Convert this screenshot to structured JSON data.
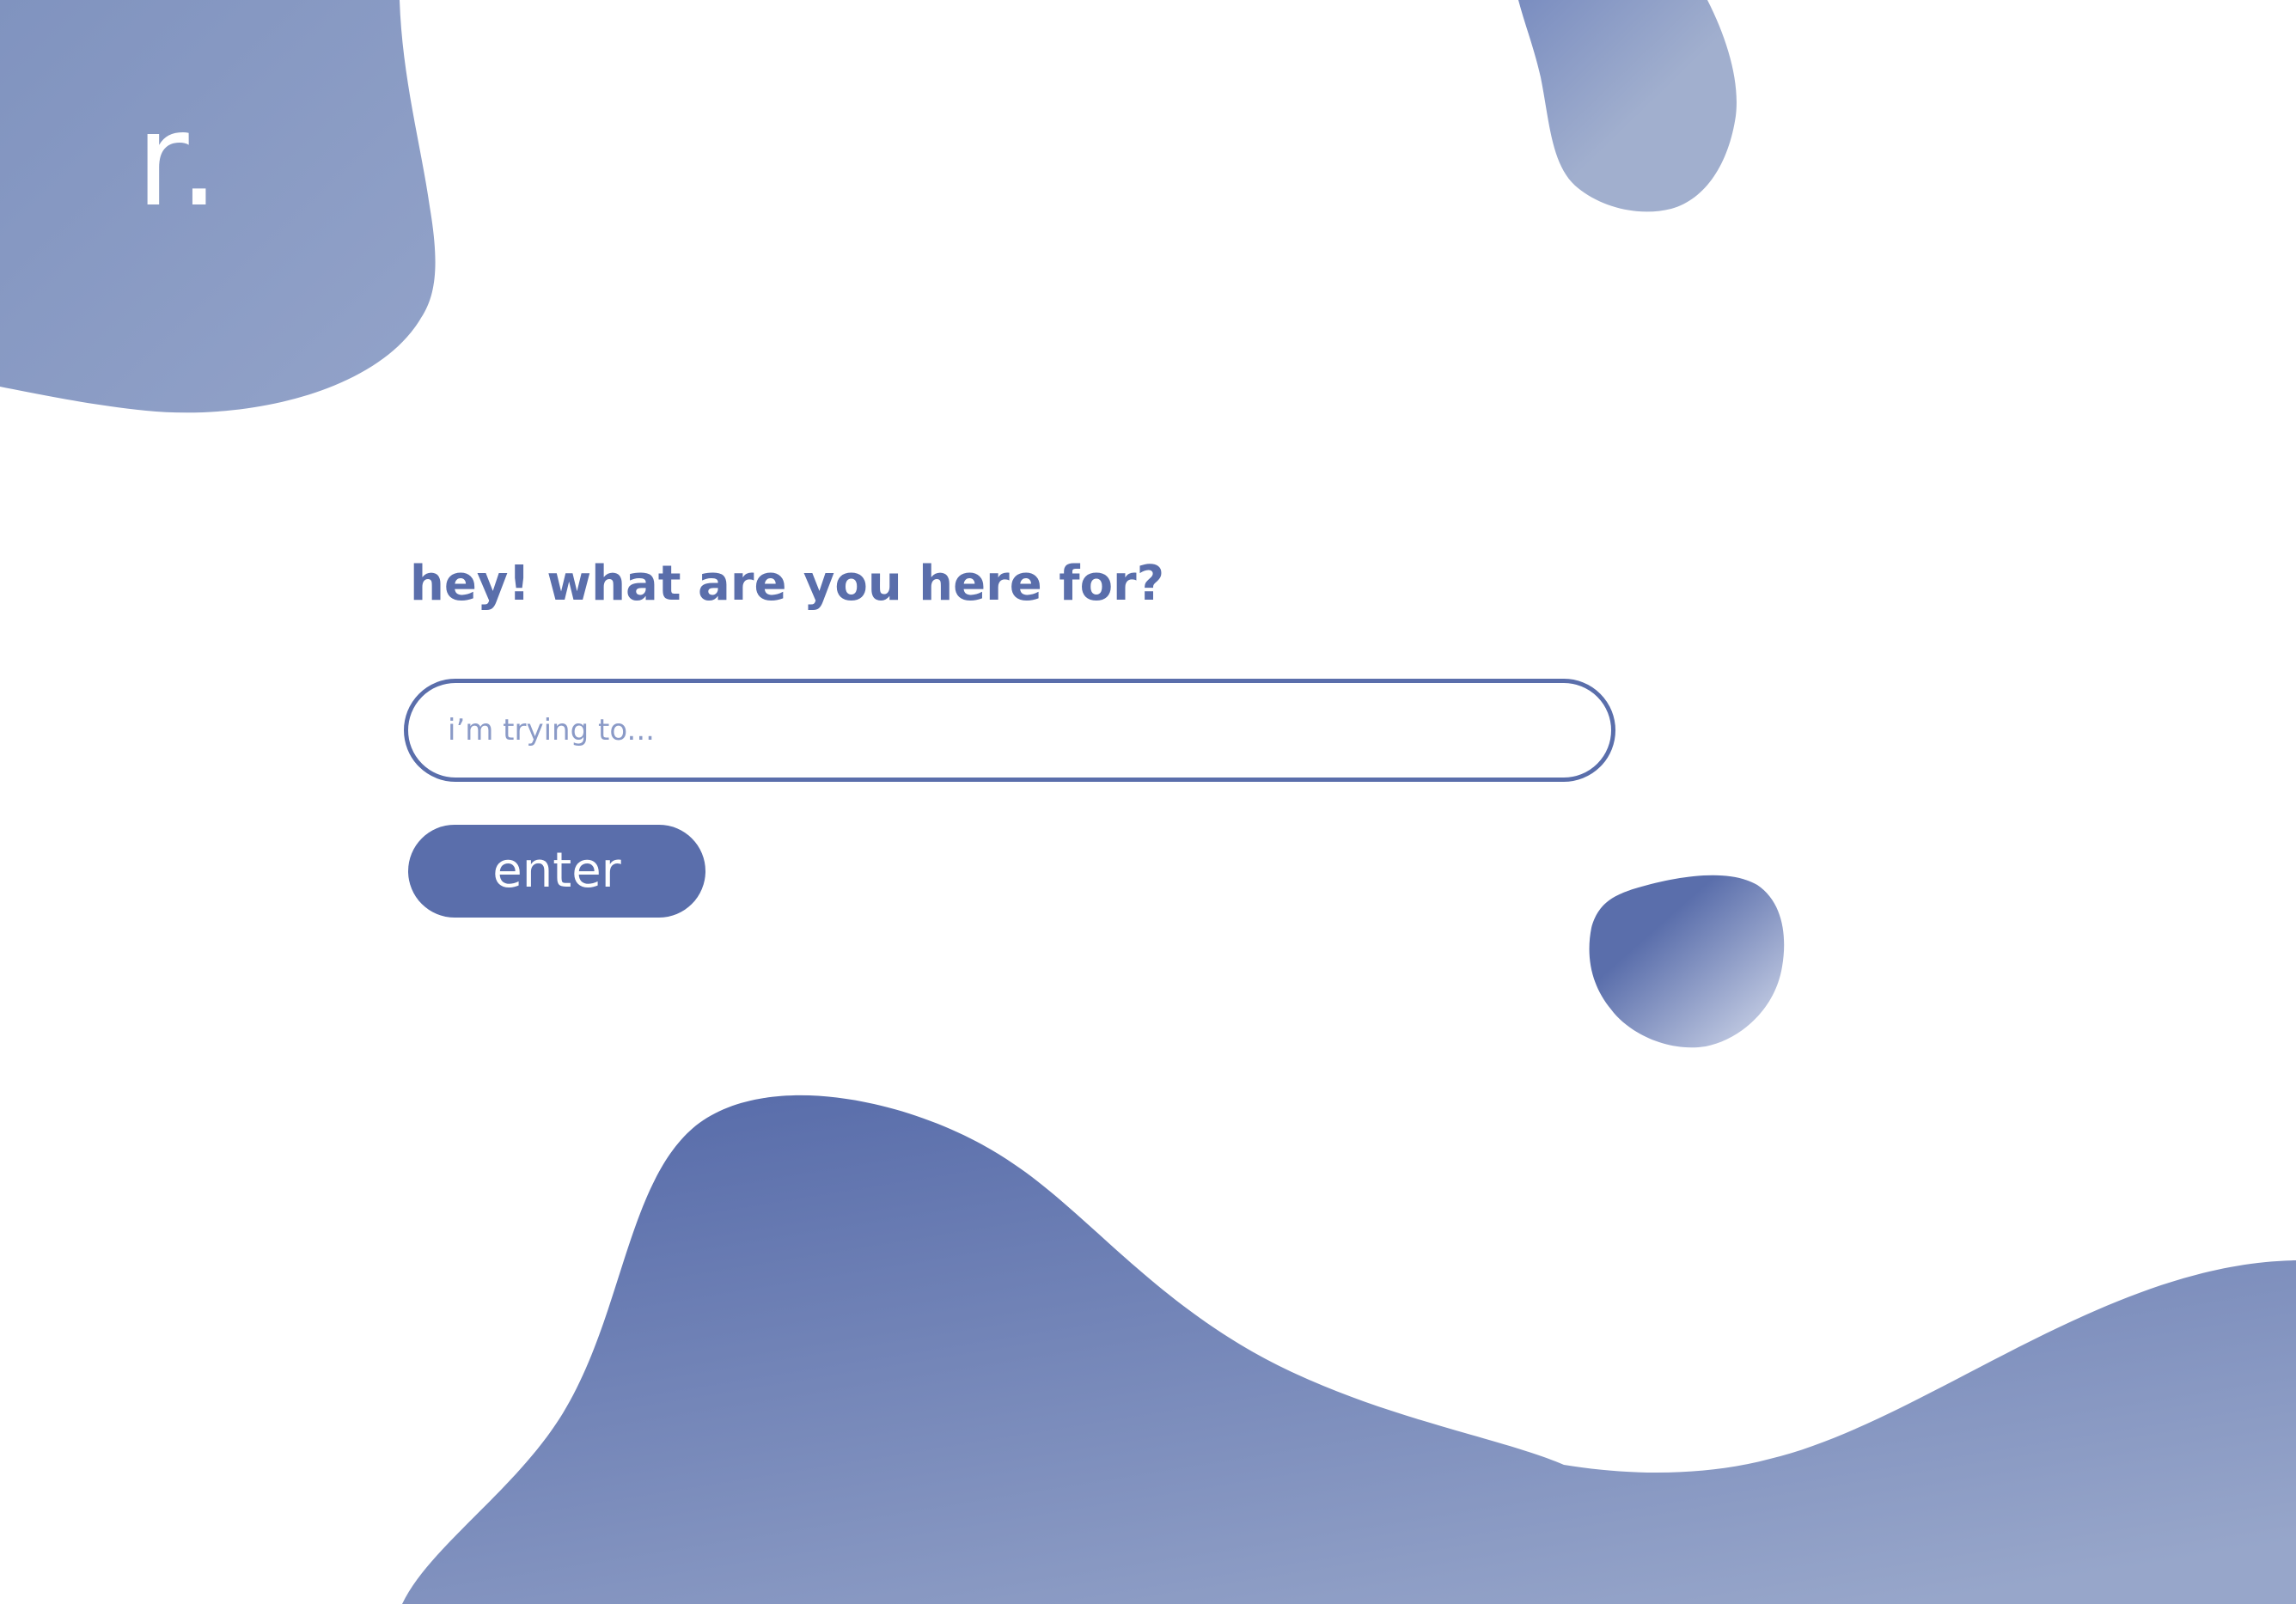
{
  "brand": {
    "logo_text": "r."
  },
  "prompt": {
    "heading": "hey! what are you here for?"
  },
  "search": {
    "value": "",
    "placeholder": "i’m trying to..."
  },
  "actions": {
    "enter_label": "enter"
  },
  "colors": {
    "accent": "#5a6eab",
    "accent_light": "#8a9ac7",
    "background": "#ffffff"
  }
}
